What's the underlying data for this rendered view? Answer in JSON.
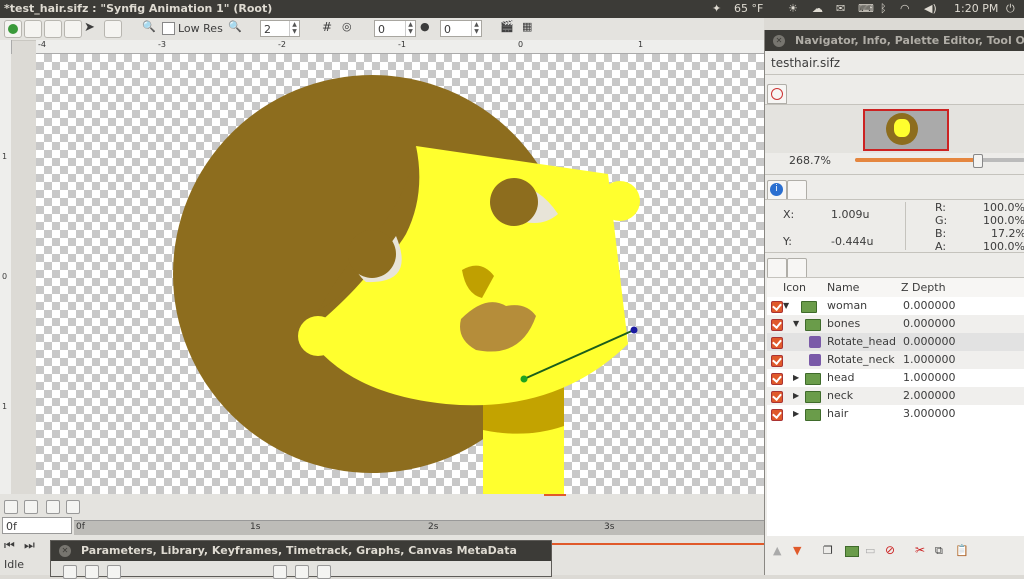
{
  "window": {
    "title": "*test_hair.sifz : \"Synfig Animation 1\" (Root)"
  },
  "system": {
    "weather": "65 °F",
    "time": "1:20 PM"
  },
  "toolbar": {
    "low_res_label": "Low Res",
    "resolution_value": "2",
    "spin_a_value": "0",
    "spin_b_value": "0"
  },
  "ruler": {
    "h_ticks": [
      "-4",
      "-3",
      "-2",
      "-1",
      "0",
      "1"
    ],
    "v_ticks": [
      "1",
      "0",
      "1"
    ]
  },
  "timebar": {
    "time_field": "0f",
    "ticks": [
      "0f",
      "1s",
      "2s",
      "3s"
    ],
    "status": "Idle"
  },
  "params_panel": {
    "title": "Parameters, Library, Keyframes, Timetrack, Graphs, Canvas MetaData"
  },
  "right_panel": {
    "title": "Navigator, Info, Palette Editor, Tool O",
    "file_tab": "testhair.sifz",
    "zoom": "268.7%",
    "zoom_level": 0.8,
    "info": {
      "x_label": "X:",
      "x_value": "1.009u",
      "y_label": "Y:",
      "y_value": "-0.444u",
      "r_label": "R:",
      "r_value": "100.0%",
      "g_label": "G:",
      "g_value": "100.0%",
      "b_label": "B:",
      "b_value": "17.2%",
      "a_label": "A:",
      "a_value": "100.0%"
    },
    "layers": {
      "col_icon": "Icon",
      "col_name": "Name",
      "col_z": "Z Depth",
      "rows": [
        {
          "name": "woman",
          "z": "0.000000"
        },
        {
          "name": "bones",
          "z": "0.000000"
        },
        {
          "name": "Rotate_head",
          "z": "0.000000"
        },
        {
          "name": "Rotate_neck",
          "z": "1.000000"
        },
        {
          "name": "head",
          "z": "1.000000"
        },
        {
          "name": "neck",
          "z": "2.000000"
        },
        {
          "name": "hair",
          "z": "3.000000"
        }
      ]
    }
  },
  "colors": {
    "hair": "#8d6d1e",
    "skin": "#ffff2e",
    "neck_shadow": "#c3a300",
    "accent": "#e05a2b"
  }
}
